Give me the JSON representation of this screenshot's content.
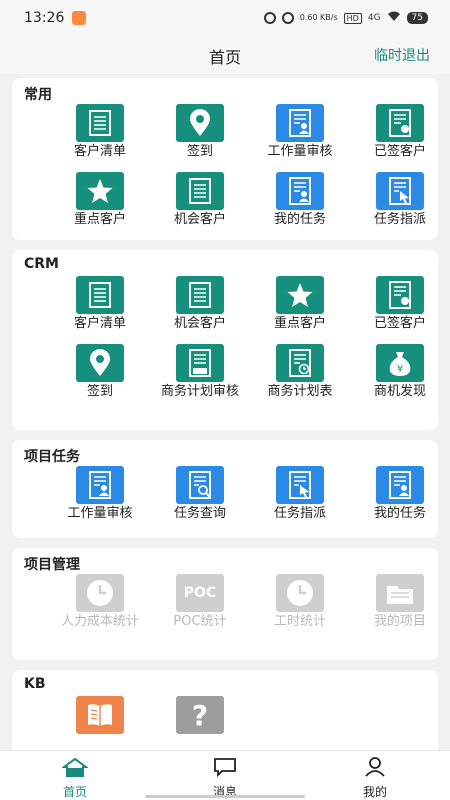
{
  "status": {
    "time": "13:26",
    "netspeed": "0.60\nKB/s",
    "hd": "HD",
    "signal": "4G",
    "battery": "75"
  },
  "header": {
    "title": "首页",
    "logout": "临时退出"
  },
  "sections": {
    "common": {
      "title": "常用",
      "items": [
        {
          "label": "客户清单",
          "icon": "list-icon",
          "color": "#16907c"
        },
        {
          "label": "签到",
          "icon": "location-pin-icon",
          "color": "#16907c"
        },
        {
          "label": "工作量审核",
          "icon": "workload-review-icon",
          "color": "#2b8ae6"
        },
        {
          "label": "已签客户",
          "icon": "signed-doc-icon",
          "color": "#16907c"
        },
        {
          "label": "重点客户",
          "icon": "star-icon",
          "color": "#16907c"
        },
        {
          "label": "机会客户",
          "icon": "list-icon",
          "color": "#16907c"
        },
        {
          "label": "我的任务",
          "icon": "my-task-icon",
          "color": "#2b8ae6"
        },
        {
          "label": "任务指派",
          "icon": "task-assign-icon",
          "color": "#2b8ae6"
        }
      ]
    },
    "crm": {
      "title": "CRM",
      "items": [
        {
          "label": "客户清单",
          "icon": "list-icon",
          "color": "#16907c"
        },
        {
          "label": "机会客户",
          "icon": "list-icon",
          "color": "#16907c"
        },
        {
          "label": "重点客户",
          "icon": "star-icon",
          "color": "#16907c"
        },
        {
          "label": "已签客户",
          "icon": "signed-doc-icon",
          "color": "#16907c"
        },
        {
          "label": "签到",
          "icon": "location-pin-icon",
          "color": "#16907c"
        },
        {
          "label": "商务计划审核",
          "icon": "plan-review-icon",
          "color": "#16907c"
        },
        {
          "label": "商务计划表",
          "icon": "plan-table-icon",
          "color": "#16907c"
        },
        {
          "label": "商机发现",
          "icon": "money-bag-icon",
          "color": "#16907c"
        }
      ]
    },
    "tasks": {
      "title": "项目任务",
      "items": [
        {
          "label": "工作量审核",
          "icon": "workload-review-icon",
          "color": "#2b8ae6"
        },
        {
          "label": "任务查询",
          "icon": "task-search-icon",
          "color": "#2b8ae6"
        },
        {
          "label": "任务指派",
          "icon": "task-assign-icon",
          "color": "#2b8ae6"
        },
        {
          "label": "我的任务",
          "icon": "my-task-icon",
          "color": "#2b8ae6"
        }
      ]
    },
    "project": {
      "title": "项目管理",
      "items": [
        {
          "label": "人力成本统计",
          "icon": "clock-icon",
          "color": "#cfcfcf"
        },
        {
          "label": "POC统计",
          "icon": "poc-icon",
          "color": "#cfcfcf",
          "glyph": "POC"
        },
        {
          "label": "工时统计",
          "icon": "clock-icon",
          "color": "#cfcfcf"
        },
        {
          "label": "我的项目",
          "icon": "folder-icon",
          "color": "#cfcfcf"
        }
      ]
    },
    "kb": {
      "title": "KB",
      "items": [
        {
          "label": "",
          "icon": "book-icon",
          "color": "#f0834a"
        },
        {
          "label": "",
          "icon": "question-icon",
          "color": "#9d9d9d",
          "glyph": "?"
        }
      ]
    }
  },
  "tabbar": {
    "home": "首页",
    "messages": "消息",
    "mine": "我的"
  }
}
